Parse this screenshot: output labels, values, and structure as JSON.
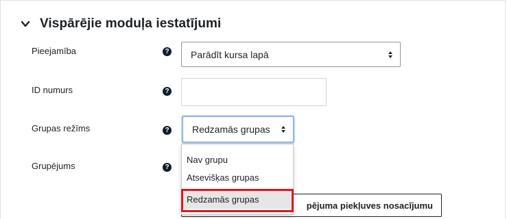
{
  "section": {
    "title": "Vispārējie moduļa iestatījumi"
  },
  "fields": {
    "availability": {
      "label": "Pieejamība",
      "value": "Parādīt kursa lapā"
    },
    "id_number": {
      "label": "ID numurs",
      "value": ""
    },
    "group_mode": {
      "label": "Grupas režīms",
      "value": "Redzamās grupas"
    },
    "grouping": {
      "label": "Grupējums"
    }
  },
  "dropdown": {
    "options": [
      "Nav grupu",
      "Atsevišķas grupas",
      "Redzamās grupas"
    ],
    "selected_index": 2
  },
  "access_button": {
    "label": "pējuma piekļuves nosacījumu"
  },
  "icons": {
    "section_toggle": "chevron-down-icon",
    "help": "question-circle-icon",
    "select_caret": "sort-caret-icon"
  },
  "colors": {
    "highlight": "#e0161d",
    "help_icon": "#0f1d2b",
    "focus_ring": "#b9d0f3"
  }
}
